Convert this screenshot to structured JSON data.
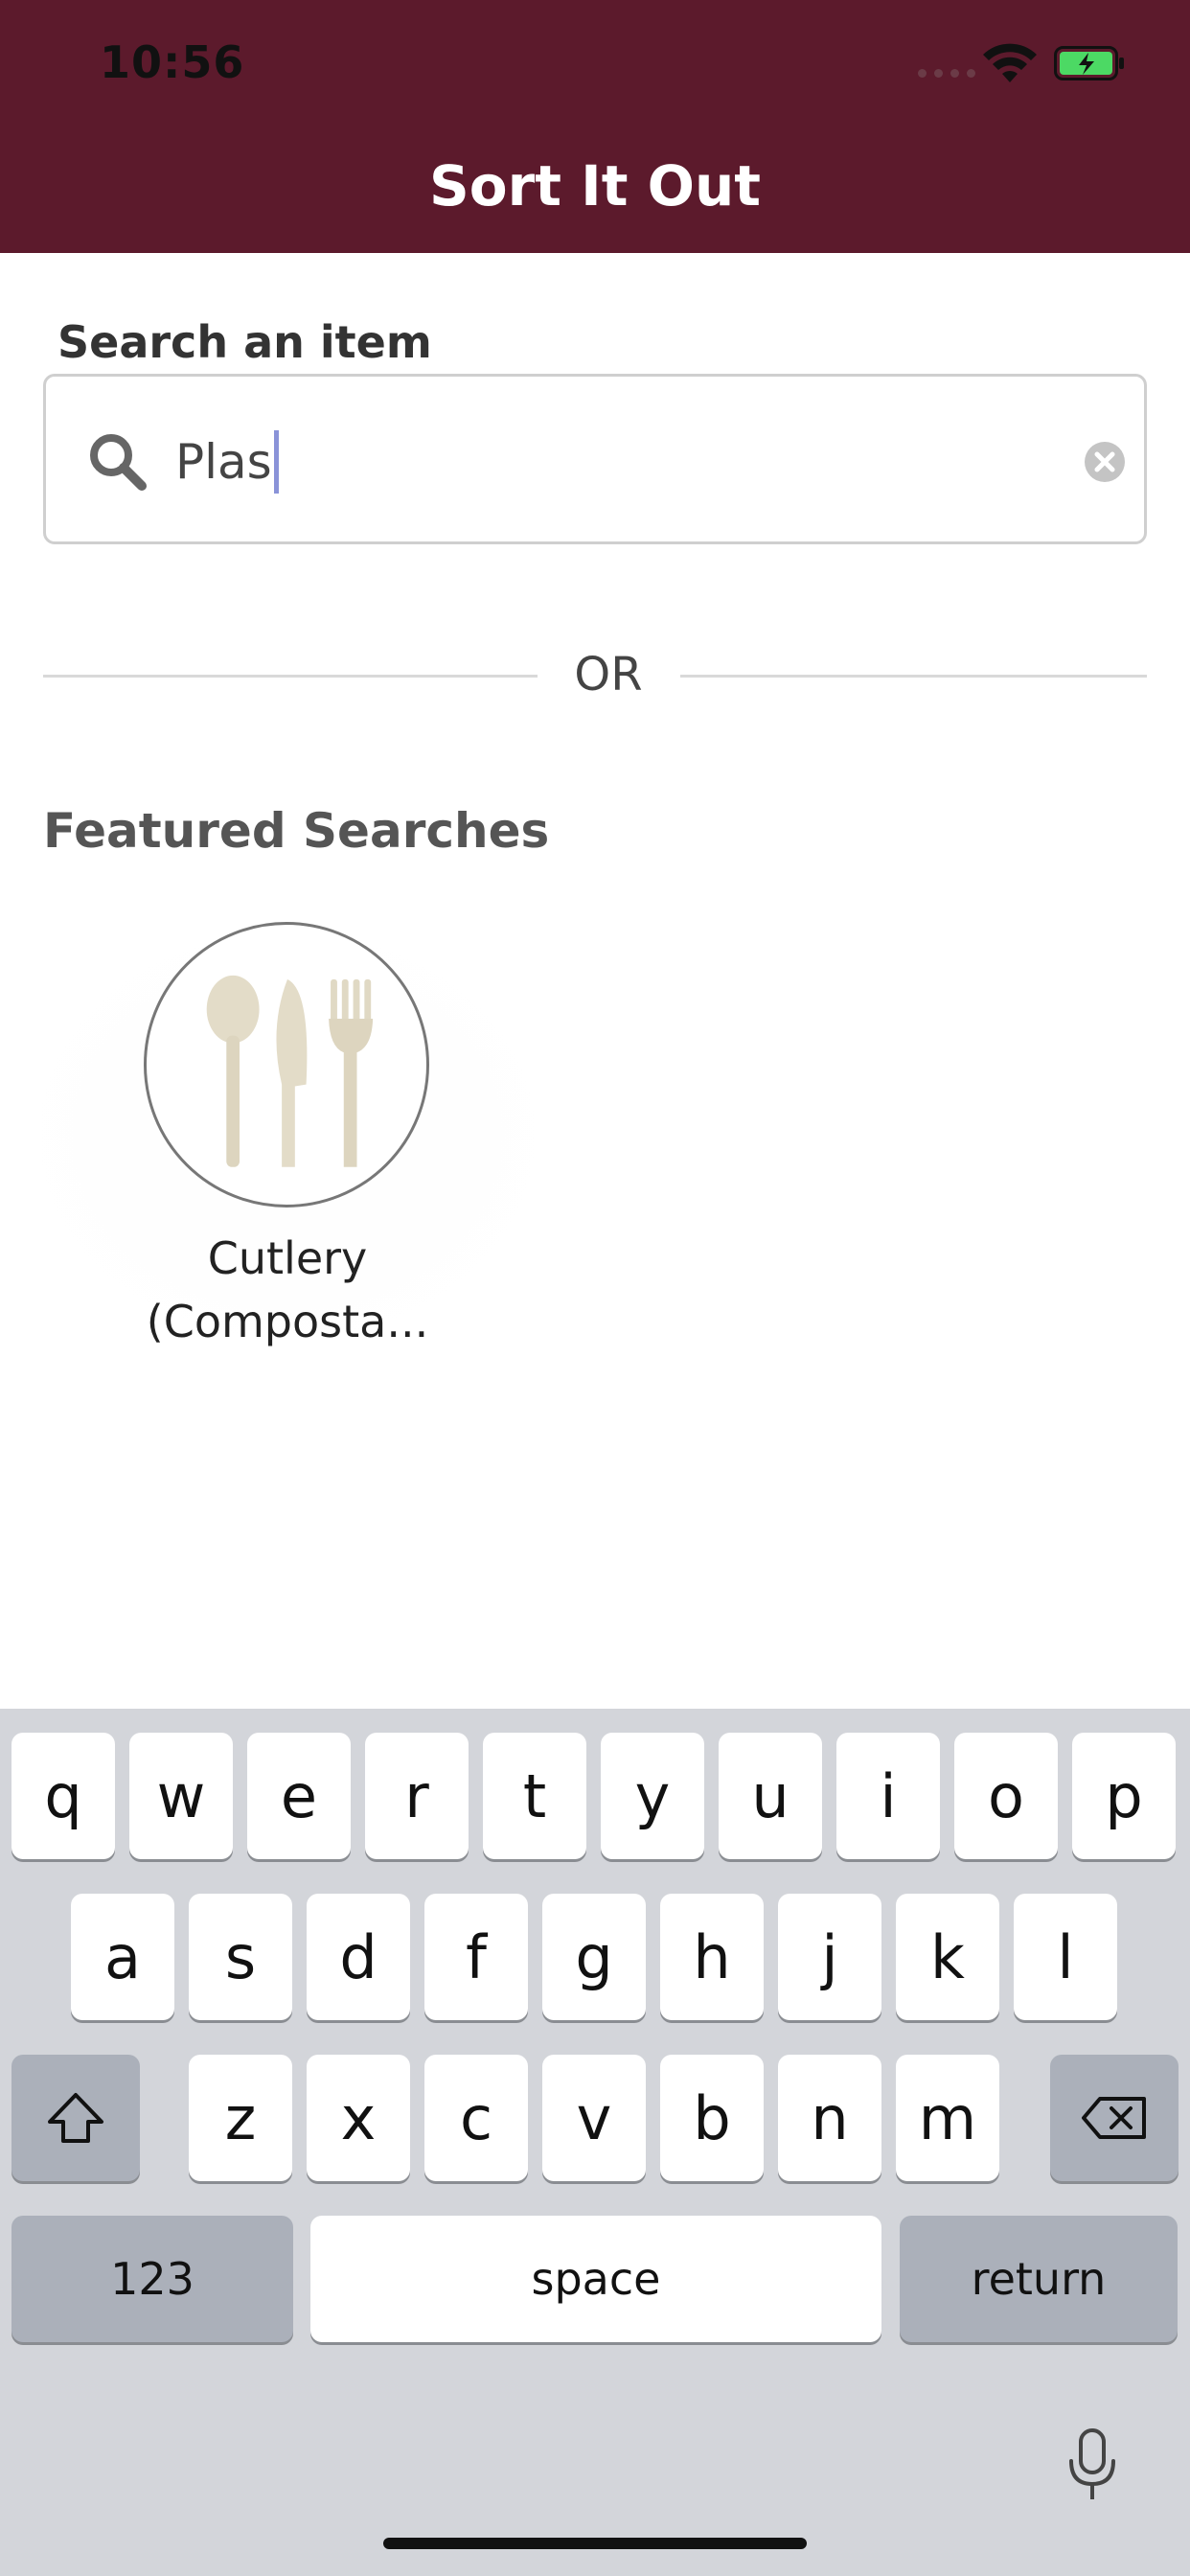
{
  "status_bar": {
    "time": "10:56",
    "icons": [
      "signal-dots-icon",
      "wifi-icon",
      "battery-charging-icon"
    ]
  },
  "header": {
    "title": "Sort It Out",
    "background_color": "#5c1a2c"
  },
  "search": {
    "label": "Search an item",
    "value": "Plas",
    "icons": [
      "search-icon",
      "clear-icon"
    ]
  },
  "divider": {
    "text": "OR"
  },
  "featured": {
    "title": "Featured Searches",
    "items": [
      {
        "label": "Cutlery (Composta...",
        "icon": "cutlery-icon"
      }
    ]
  },
  "keyboard": {
    "row1": [
      "q",
      "w",
      "e",
      "r",
      "t",
      "y",
      "u",
      "i",
      "o",
      "p"
    ],
    "row2": [
      "a",
      "s",
      "d",
      "f",
      "g",
      "h",
      "j",
      "k",
      "l"
    ],
    "row3": [
      "z",
      "x",
      "c",
      "v",
      "b",
      "n",
      "m"
    ],
    "numbers_key": "123",
    "space_key": "space",
    "return_key": "return",
    "icons": [
      "shift-icon",
      "backspace-icon",
      "microphone-icon"
    ]
  }
}
